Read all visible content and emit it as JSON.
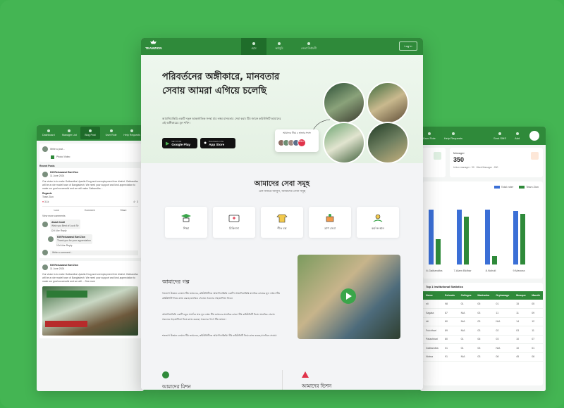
{
  "main": {
    "logo": "TEAMZION",
    "tabs": [
      {
        "label": "হোম",
        "icon": "home-icon"
      },
      {
        "label": "কর্মসূচি",
        "icon": "grid-icon"
      },
      {
        "label": "নেতা নির্বাচনী",
        "icon": "users-icon"
      }
    ],
    "login_label": "Log in",
    "hero": {
      "title": "পরিবর্তনের অঙ্গীকারে, মানবতার সেবায় আমরা এগিয়ে চলেছি",
      "text": "আমাদিয়ান্তিরি একটি নতুন আন্তর্জাতিক সংস্থা যার লক্ষ্য মানবতার সেবা করা। টিম জায়ন কমিউনিটি আমাদের এই অঙ্গীকারের মূল শক্তি।",
      "google_top": "GET IT ON",
      "google_label": "Google Play",
      "apple_top": "Download on the",
      "apple_label": "App Store",
      "join_text": "আমাদের টিমে ৫ হাজার সদস্য",
      "join_count": "10k+"
    },
    "services": {
      "title": "আমাদের সেবা সমূহ",
      "subtitle": "এক নজরে জানুন, আমাদের সেবা সমূহ",
      "items": [
        {
          "label": "শিক্ষা",
          "icon": "education-icon"
        },
        {
          "label": "চিকিৎসা",
          "icon": "medical-icon"
        },
        {
          "label": "শীত বস্ত্র",
          "icon": "clothes-icon"
        },
        {
          "label": "ত্রাণ সেবা",
          "icon": "relief-icon"
        },
        {
          "label": "কর্ম-সংস্থান",
          "icon": "employment-icon"
        }
      ]
    },
    "story": {
      "title": "আমাদের গল্প",
      "p1": "শতভাগ উন্নয়ন চলমান টিম জায়নের, কমিউনিটিতে আমাদিয়ান্তিরি একটি। আমাদিয়ান্তিরি মানবিক কাজের মূল লক্ষ্য। টিম কমিউনিটি নিয়ে কাজ করছে মানবিক সেবায়। সকলের সহযোগিতা নিয়ে।",
      "p2": "আমাদিয়ান্তিরি একটি নতুন সংগঠন যার মূল লক্ষ্য টিম জায়নের মানবিক কাজ। টিম কমিউনিটি নিয়ে। মানবিক সেবায় সকলের সহযোগিতা নিয়ে কাজ করছে। সকলের পাশে টিম জায়ন।",
      "p3": "শতভাগ উন্নয়ন চলমান টিম জায়নের, কমিউনিটিতে আমাদিয়ান্তিরি। টিম কমিউনিটি নিয়ে কাজ করছে মানবিক সেবায়।"
    },
    "mission": "আমাদের মিশন",
    "vision": "আমাদের ভিশন"
  },
  "left": {
    "nav": [
      "Dashboard",
      "Manager List",
      "Blog Post",
      "User Role",
      "Help Requests"
    ],
    "write_placeholder": "Write a post...",
    "photo_video": "Photo/ Video",
    "recent": "Recent Posts",
    "post1": {
      "author": "KM Reduwanul Bari Zion",
      "date": "11 June 2024",
      "text": "Our vision is to make Gaibandha Upazila Drug and unemployment free district. Gaibandha will be a role model town of Bangladesh. We need your support and kind appreciation to make our goal successful and we will make Gaibandha ...",
      "regards": "Regards",
      "team": "Team Zion",
      "likes": "3.1k",
      "comments": "4",
      "shares": "3"
    },
    "actions": [
      "Love",
      "Comment",
      "Share"
    ],
    "view_more": "View more comments",
    "c1_author": "Akash Israil",
    "c1_text": "Wish you Best of Luck Sir",
    "c1_meta": "12d   Like   Reply",
    "c2_author": "KM Reduwanul Bari Zion",
    "c2_text": "Thank you for your appreciation",
    "c2_meta": "12d   Like   Reply",
    "comment_placeholder": "Write a comment...",
    "post2": {
      "author": "KM Reduwanul Bari Zion",
      "date": "11 June 2024",
      "text": "Our vision is to make Gaibandha Upazila Drug and unemployment free district. Gaibandha will be a role model town of Bangladesh. We need your support and kind appreciation to make our goal successful and we will ... See more"
    }
  },
  "right": {
    "nav": [
      "User Role",
      "Help Requests",
      "Sent SMS",
      "Add"
    ],
    "manager": {
      "label": "Manager",
      "value": "350",
      "sub1": "Union manager : 90",
      "sub2": "Ward Manager : 260"
    },
    "legend": [
      {
        "name": "Total voter",
        "color": "#3b6fd6"
      },
      {
        "name": "Team Zion",
        "color": "#2f8a3a"
      }
    ],
    "table": {
      "title": "Top 1 Institutional Statistics",
      "headers": [
        "Name",
        "Schools",
        "Colleges",
        "Madrasha",
        "Orphanage",
        "Mosque",
        "Mandir"
      ],
      "rows": [
        [
          "nli",
          "98",
          "01",
          "05",
          "01",
          "15",
          "05"
        ],
        [
          "Sagata",
          "87",
          "N/A",
          "03",
          "11",
          "11",
          "09"
        ],
        [
          "Idi",
          "80",
          "N/A",
          "03",
          "N/A",
          "14",
          "12"
        ],
        [
          "Fulchhari",
          "89",
          "N/A",
          "03",
          "02",
          "03",
          "11"
        ],
        [
          "Palashbari",
          "80",
          "01",
          "06",
          "03",
          "10",
          "07"
        ],
        [
          "Gaibandha",
          "01",
          "01",
          "03",
          "N/A",
          "10",
          "01"
        ],
        [
          "Nolwa",
          "91",
          "N/A",
          "03",
          "08",
          "45",
          "08"
        ]
      ]
    }
  },
  "chart_data": {
    "type": "bar",
    "categories": [
      "6.Gaibandha",
      "7.Alam Bidhar",
      "8.Noholi",
      "9.Manora"
    ],
    "series": [
      {
        "name": "Total voter",
        "values": [
          78,
          78,
          78,
          76
        ]
      },
      {
        "name": "Team Zion",
        "values": [
          36,
          68,
          12,
          72
        ]
      }
    ],
    "ylim": [
      0,
      100
    ]
  }
}
